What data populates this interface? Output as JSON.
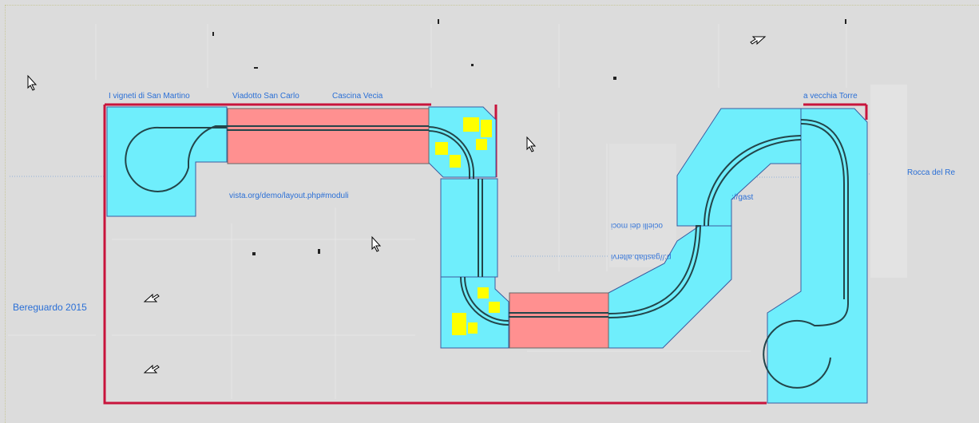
{
  "labels": {
    "vigneti": "I vigneti di San Martino",
    "viadotto": "Viadotto San Carlo",
    "cascina": "Cascina Vecia",
    "torre": "a vecchia Torre",
    "rocca": "Rocca del Re",
    "url": "vista.org/demo/layout.php#moduli",
    "bereguardo": "Bereguardo 2015",
    "gast": "://gast",
    "mirror1": "ocielli dei moci",
    "mirror2": "p://gastlab.altervi"
  },
  "colors": {
    "module": "#6feefc",
    "bridge": "#ff9090",
    "boundary": "#c8143c",
    "track": "#23454a",
    "scenery": "#ffff00",
    "label": "#2a6fd6"
  },
  "icons": [
    "cursor-arrow-icon",
    "cursor-arrow-mirrored-icon",
    "tick-mark-icon"
  ]
}
